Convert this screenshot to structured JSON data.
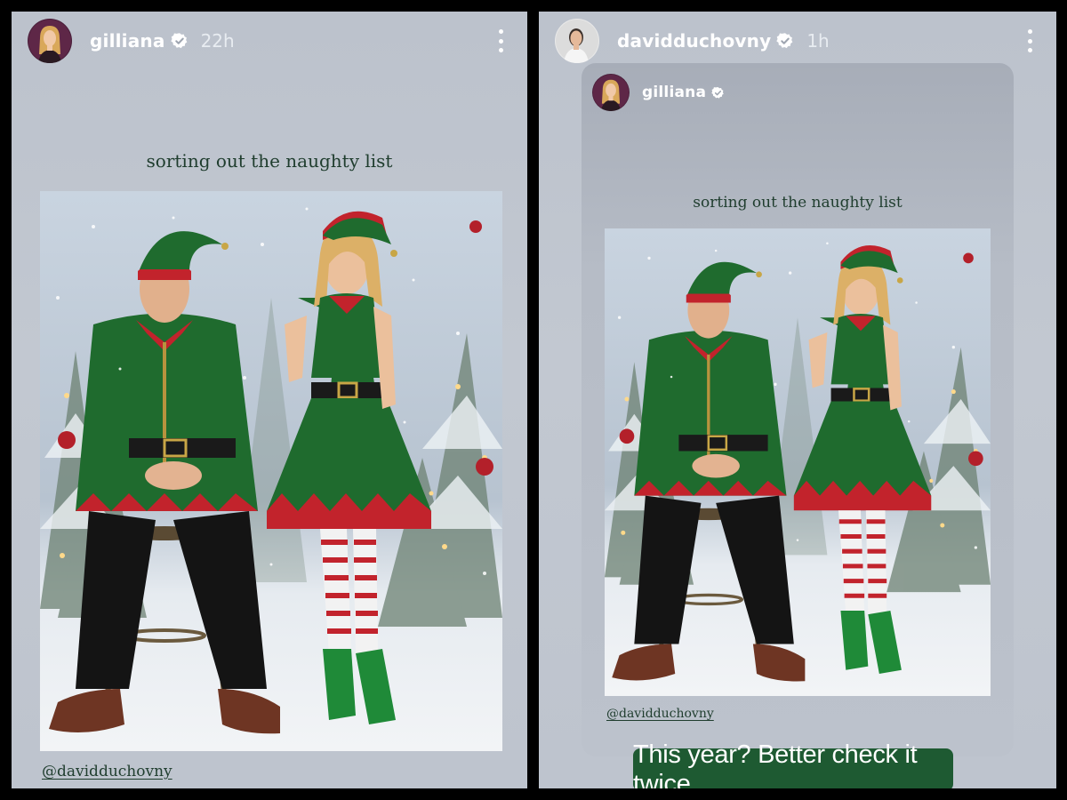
{
  "stories": [
    {
      "username": "gilliana",
      "time": "22h",
      "caption": "sorting out the naughty list",
      "mention": "@davidduchovny"
    },
    {
      "username": "davidduchovny",
      "time": "1h",
      "reposted": {
        "username": "gilliana",
        "caption": "sorting out the naughty list",
        "mention": "@davidduchovny"
      },
      "sticker_text": "This year? Better check it twice."
    }
  ],
  "icons": {
    "verified": "verified-badge-icon",
    "more": "more-vertical-icon"
  },
  "colors": {
    "story_bg": "#bfc5cf",
    "caption_text": "#1f3d2e",
    "sticker_bg": "#1e5a32"
  }
}
